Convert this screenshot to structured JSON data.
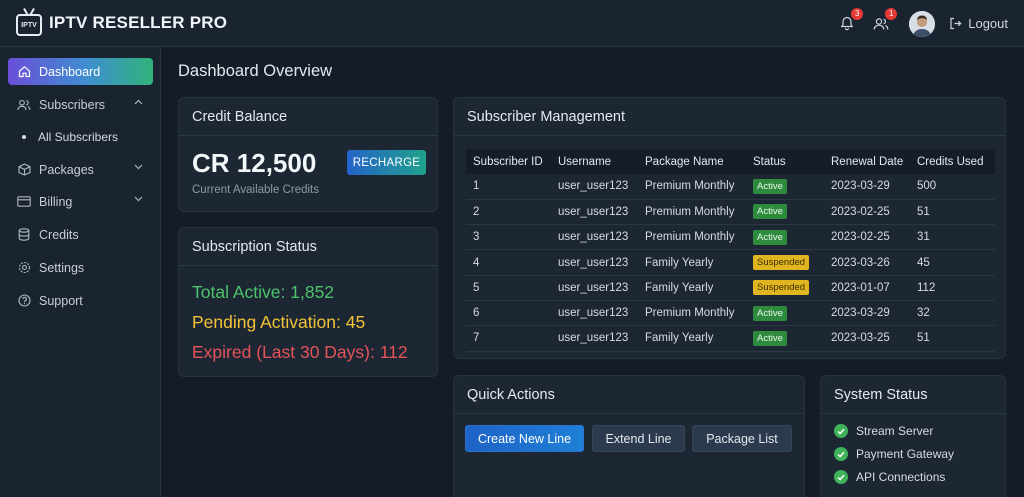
{
  "app": {
    "title": "IPTV RESELLER PRO",
    "logo_text": "IPTV"
  },
  "header": {
    "notifications_count": "3",
    "users_count": "1",
    "logout_label": "Logout"
  },
  "sidebar": {
    "items": [
      {
        "label": "Dashboard",
        "icon": "home-icon"
      },
      {
        "label": "Subscribers",
        "icon": "users-icon",
        "expanded": true
      },
      {
        "label": "Packages",
        "icon": "box-icon"
      },
      {
        "label": "Billing",
        "icon": "card-icon"
      },
      {
        "label": "Credits",
        "icon": "database-icon"
      },
      {
        "label": "Settings",
        "icon": "gear-icon"
      },
      {
        "label": "Support",
        "icon": "help-icon"
      }
    ],
    "sub_items": [
      {
        "label": "All Subscribers"
      }
    ]
  },
  "main": {
    "page_title": "Dashboard Overview",
    "credit": {
      "title": "Credit Balance",
      "amount": "CR 12,500",
      "subtitle": "Current Available Credits",
      "recharge_label": "RECHARGE"
    },
    "subscription": {
      "title": "Subscription Status",
      "active": "Total Active: 1,852",
      "pending": "Pending Activation: 45",
      "expired": "Expired (Last 30 Days): 112"
    },
    "subscribers": {
      "title": "Subscriber Management",
      "columns": [
        "Subscriber ID",
        "Username",
        "Package Name",
        "Status",
        "Renewal Date",
        "Credits Used"
      ],
      "rows": [
        [
          "1",
          "user_user123",
          "Premium Monthly",
          "Active",
          "2023-03-29",
          "500"
        ],
        [
          "2",
          "user_user123",
          "Premium Monthly",
          "Active",
          "2023-02-25",
          "51"
        ],
        [
          "3",
          "user_user123",
          "Premium Monthly",
          "Active",
          "2023-02-25",
          "31"
        ],
        [
          "4",
          "user_user123",
          "Family Yearly",
          "Suspended",
          "2023-03-26",
          "45"
        ],
        [
          "5",
          "user_user123",
          "Family Yearly",
          "Suspended",
          "2023-01-07",
          "112"
        ],
        [
          "6",
          "user_user123",
          "Premium Monthly",
          "Active",
          "2023-03-29",
          "32"
        ],
        [
          "7",
          "user_user123",
          "Family Yearly",
          "Active",
          "2023-03-25",
          "51"
        ]
      ]
    },
    "quick_actions": {
      "title": "Quick Actions",
      "buttons": [
        "Create New Line",
        "Extend Line",
        "Package List"
      ]
    },
    "system_status": {
      "title": "System Status",
      "items": [
        "Stream Server",
        "Payment Gateway",
        "API Connections"
      ]
    }
  },
  "colors": {
    "accent_green": "#4cc36a",
    "accent_yellow": "#f2c335",
    "accent_red": "#e5535a",
    "status_active": "#2e8b3e",
    "status_suspended": "#e0b520"
  }
}
